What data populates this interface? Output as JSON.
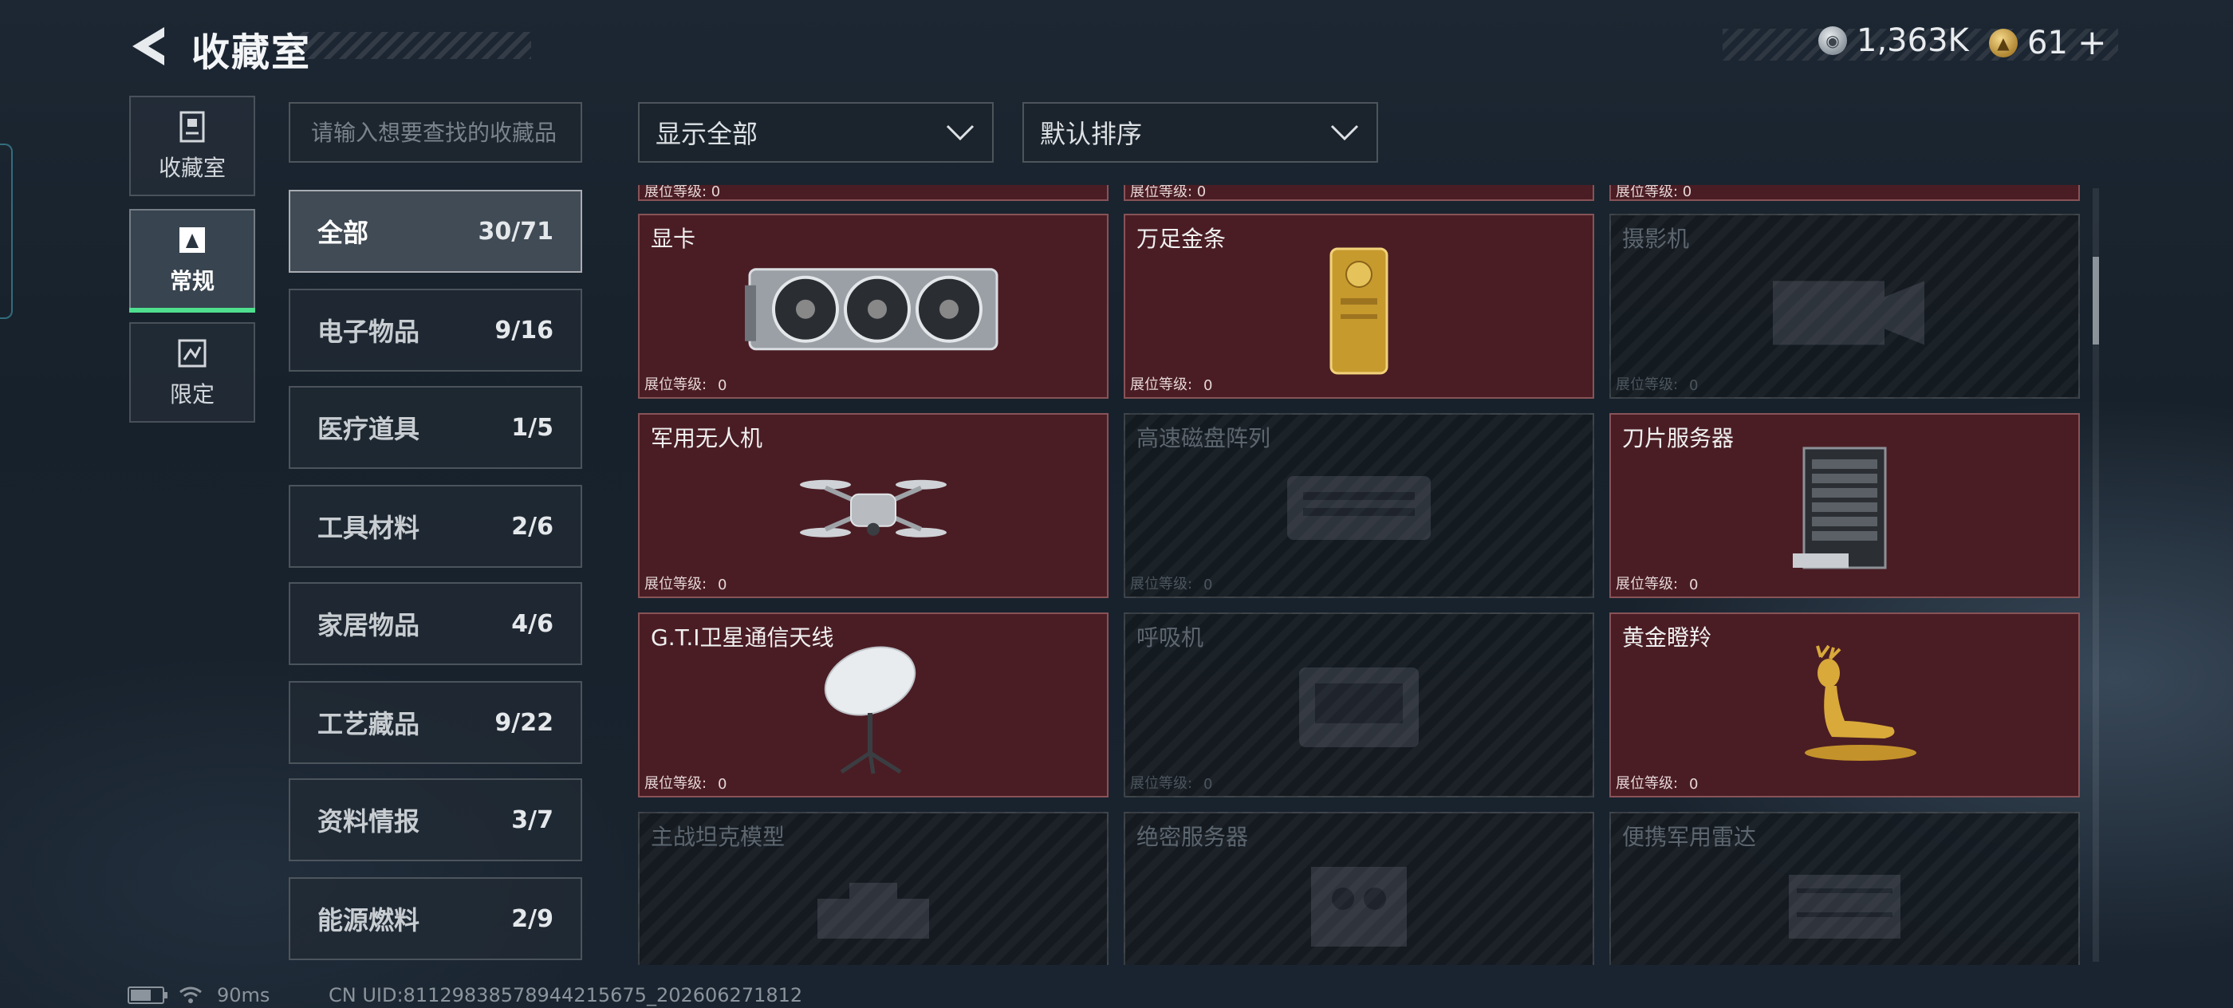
{
  "header": {
    "title": "收藏室",
    "currencies": [
      {
        "icon": "silver-coin-icon",
        "amount": "1,363K"
      },
      {
        "icon": "gold-coin-icon",
        "amount": "61"
      }
    ],
    "add_label": "+"
  },
  "rail": [
    {
      "label": "收藏室",
      "icon": "collection-room-icon",
      "active": false
    },
    {
      "label": "常规",
      "icon": "regular-icon",
      "active": true
    },
    {
      "label": "限定",
      "icon": "limited-icon",
      "active": false
    }
  ],
  "search": {
    "placeholder": "请输入想要查找的收藏品"
  },
  "categories": [
    {
      "label": "全部",
      "count": "30/71",
      "active": true
    },
    {
      "label": "电子物品",
      "count": "9/16"
    },
    {
      "label": "医疗道具",
      "count": "1/5"
    },
    {
      "label": "工具材料",
      "count": "2/6"
    },
    {
      "label": "家居物品",
      "count": "4/6"
    },
    {
      "label": "工艺藏品",
      "count": "9/22"
    },
    {
      "label": "资料情报",
      "count": "3/7"
    },
    {
      "label": "能源燃料",
      "count": "2/9"
    }
  ],
  "filters": {
    "display": "显示全部",
    "sort": "默认排序"
  },
  "level_label": "展位等级:",
  "items": [
    {
      "name": "显卡",
      "level": "0",
      "owned": true,
      "icon": "graphics-card-icon"
    },
    {
      "name": "万足金条",
      "level": "0",
      "owned": true,
      "icon": "gold-bar-icon"
    },
    {
      "name": "摄影机",
      "level": "0",
      "owned": false,
      "icon": "camera-icon"
    },
    {
      "name": "军用无人机",
      "level": "0",
      "owned": true,
      "icon": "drone-icon"
    },
    {
      "name": "高速磁盘阵列",
      "level": "0",
      "owned": false,
      "icon": "disk-array-icon"
    },
    {
      "name": "刀片服务器",
      "level": "0",
      "owned": true,
      "icon": "blade-server-icon"
    },
    {
      "name": "G.T.I卫星通信天线",
      "level": "0",
      "owned": true,
      "icon": "satellite-antenna-icon"
    },
    {
      "name": "呼吸机",
      "level": "0",
      "owned": false,
      "icon": "ventilator-icon"
    },
    {
      "name": "黄金瞪羚",
      "level": "0",
      "owned": true,
      "icon": "golden-gazelle-icon"
    },
    {
      "name": "主战坦克模型",
      "level": "",
      "owned": false,
      "icon": "tank-model-icon"
    },
    {
      "name": "绝密服务器",
      "level": "",
      "owned": false,
      "icon": "secret-server-icon"
    },
    {
      "name": "便携军用雷达",
      "level": "",
      "owned": false,
      "icon": "radar-icon"
    }
  ],
  "top_partial_level": "展位等级: 0",
  "footer": {
    "ping": "90ms",
    "uid": "CN UID:81129838578944215675_202606271812"
  },
  "colors": {
    "owned_card": "#4a1d24",
    "active_tab_accent": "#4fe08f"
  }
}
